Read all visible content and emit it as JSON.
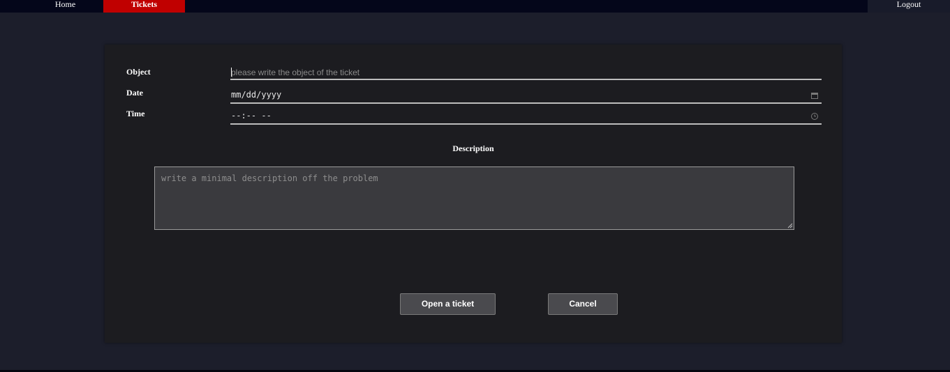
{
  "nav": {
    "home": "Home",
    "tickets": "Tickets",
    "logout": "Logout"
  },
  "form": {
    "object_label": "Object",
    "object_placeholder": "please write the object of the ticket",
    "date_label": "Date",
    "date_value": "mm/dd/yyyy",
    "time_label": "Time",
    "time_value": "--:-- --",
    "description_label": "Description",
    "description_placeholder": "write a minimal description off the problem"
  },
  "actions": {
    "open_label": "Open a ticket",
    "cancel_label": "Cancel"
  },
  "icons": {
    "date": "calendar-icon",
    "time": "clock-icon",
    "resize": "resize-handle-icon"
  },
  "colors": {
    "active_tab": "#c00000",
    "page_background": "#1c1e2b",
    "navbar": "#04061a",
    "card": "#1c1c20",
    "button": "#4a4a4e"
  }
}
